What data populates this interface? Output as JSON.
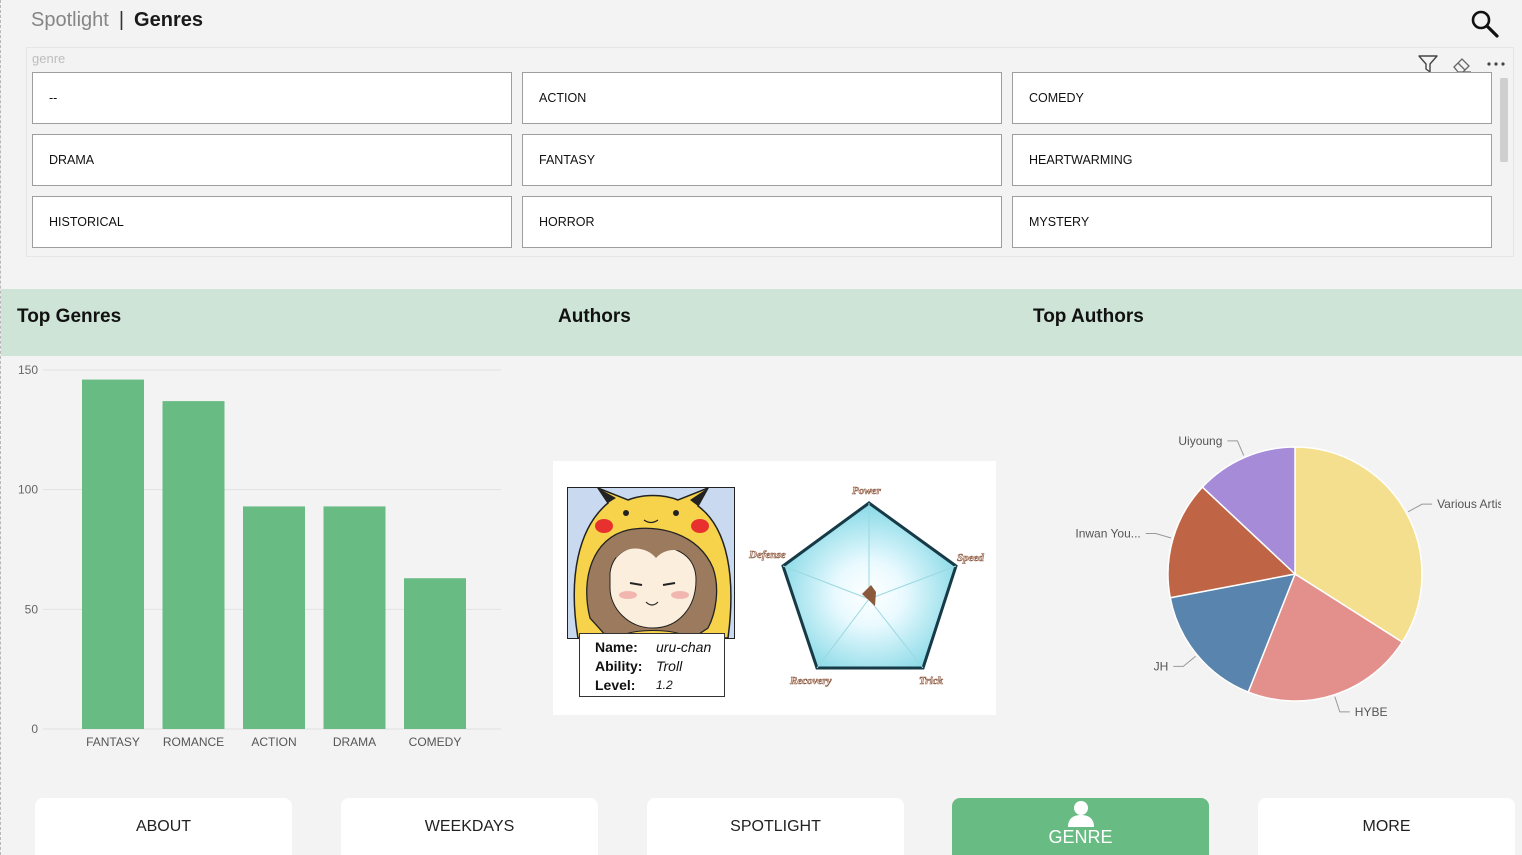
{
  "header": {
    "breadcrumb_parent": "Spotlight",
    "breadcrumb_separator": "|",
    "breadcrumb_current": "Genres",
    "search_icon": "search-icon"
  },
  "slicer": {
    "title": "genre",
    "tools": [
      "filter-icon",
      "eraser-icon",
      "more-options-icon"
    ],
    "options": [
      "--",
      "ACTION",
      "COMEDY",
      "DRAMA",
      "FANTASY",
      "HEARTWARMING",
      "HISTORICAL",
      "HORROR",
      "MYSTERY"
    ]
  },
  "sections": {
    "top_genres": "Top Genres",
    "authors": "Authors",
    "top_authors": "Top Authors"
  },
  "author_card": {
    "name_label": "Name:",
    "name_value": "uru-chan",
    "ability_label": "Ability:",
    "ability_value": "Troll",
    "level_label": "Level:",
    "level_value": "1.2",
    "radar_labels": [
      "Power",
      "Speed",
      "Trick",
      "Recovery",
      "Defense"
    ]
  },
  "nav": {
    "about": "ABOUT",
    "weekdays": "WEEKDAYS",
    "spotlight": "SPOTLIGHT",
    "genre": "GENRE",
    "more": "MORE",
    "genre_icon": "user-icon"
  },
  "colors": {
    "accent": "#69bb84",
    "band": "#cde4d6"
  },
  "chart_data": [
    {
      "type": "bar",
      "title": "Top Genres",
      "categories": [
        "FANTASY",
        "ROMANCE",
        "ACTION",
        "DRAMA",
        "COMEDY"
      ],
      "values": [
        146,
        137,
        93,
        93,
        63
      ],
      "ylim": [
        0,
        150
      ],
      "yticks": [
        0,
        50,
        100,
        150
      ],
      "grid": true,
      "color": "#69bb84"
    },
    {
      "type": "pie",
      "title": "Top Authors",
      "labels": [
        "Various Artists",
        "HYBE",
        "JH",
        "Inwan You...",
        "Uiyoung"
      ],
      "values": [
        34,
        22,
        16,
        15,
        13
      ],
      "colors": [
        "#f3df8e",
        "#e3908d",
        "#5884ad",
        "#bf6545",
        "#a58bd8"
      ]
    }
  ]
}
